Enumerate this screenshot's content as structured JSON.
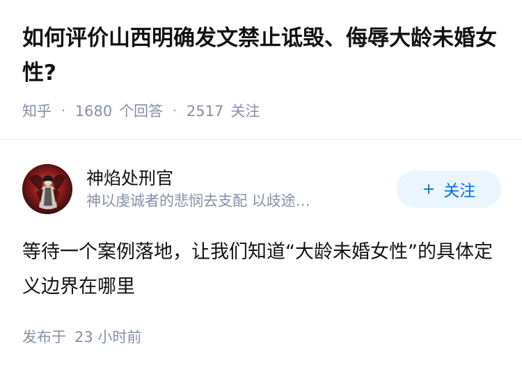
{
  "question": {
    "title": "如何评价山西明确发文禁止诋毁、侮辱大龄未婚女性?",
    "source": "知乎",
    "answers_count": "1680",
    "answers_label": "个回答",
    "follow_count": "2517",
    "follow_label": "关注",
    "separator": "·"
  },
  "answer": {
    "author": {
      "name": "神焰处刑官",
      "bio": "神以虔诚者的悲悯去支配 以歧途…",
      "avatar": "avatar-icon"
    },
    "follow_button": {
      "plus": "+",
      "label": "关注"
    },
    "content": "等待一个案例落地，让我们知道“大龄未婚女性”的具体定义边界在哪里",
    "published_label": "发布于",
    "published_time": "23 小时前"
  },
  "colors": {
    "text_primary": "#121212",
    "text_secondary": "#8590a6",
    "accent": "#056de8",
    "button_bg": "#ebf5ff",
    "divider": "#ebebeb"
  }
}
